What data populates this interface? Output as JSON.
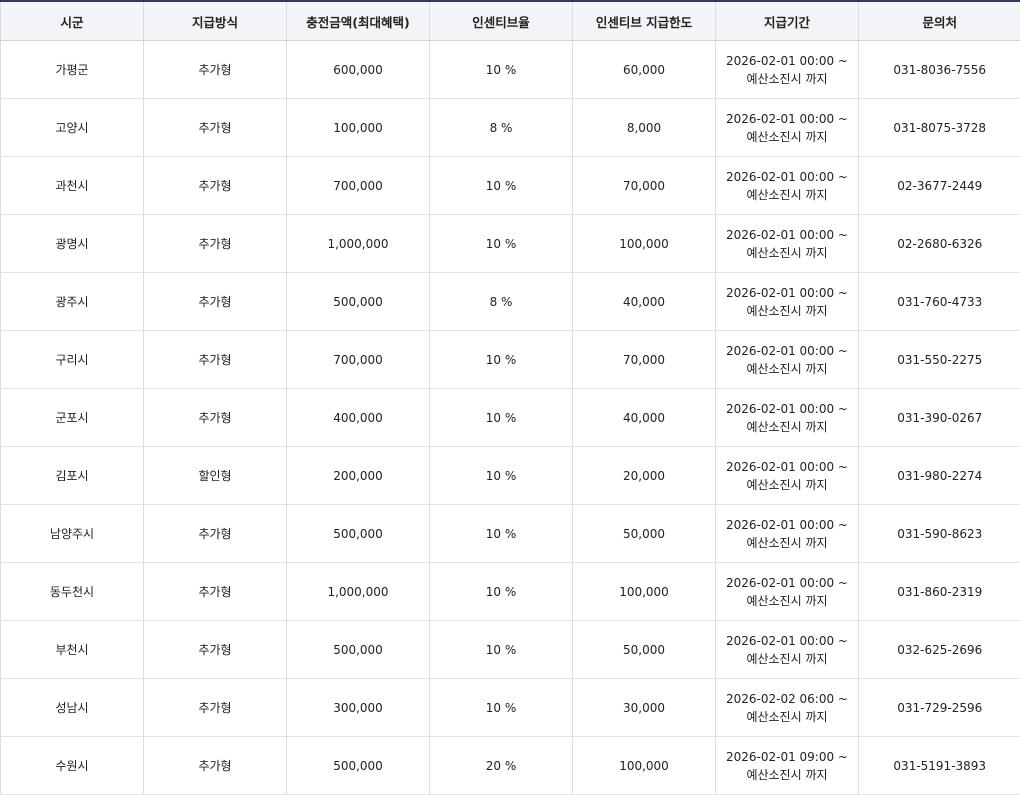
{
  "table": {
    "headers": [
      "시군",
      "지급방식",
      "충전금액(최대혜택)",
      "인센티브율",
      "인센티브 지급한도",
      "지급기간",
      "문의처"
    ],
    "rows": [
      {
        "region": "가평군",
        "method": "추가형",
        "amount": "600,000",
        "rate": "10 %",
        "limit": "60,000",
        "period": "2026-02-01 00:00 ~ 예산소진시 까지",
        "contact": "031-8036-7556"
      },
      {
        "region": "고양시",
        "method": "추가형",
        "amount": "100,000",
        "rate": "8 %",
        "limit": "8,000",
        "period": "2026-02-01 00:00 ~ 예산소진시 까지",
        "contact": "031-8075-3728"
      },
      {
        "region": "과천시",
        "method": "추가형",
        "amount": "700,000",
        "rate": "10 %",
        "limit": "70,000",
        "period": "2026-02-01 00:00 ~ 예산소진시 까지",
        "contact": "02-3677-2449"
      },
      {
        "region": "광명시",
        "method": "추가형",
        "amount": "1,000,000",
        "rate": "10 %",
        "limit": "100,000",
        "period": "2026-02-01 00:00 ~ 예산소진시 까지",
        "contact": "02-2680-6326"
      },
      {
        "region": "광주시",
        "method": "추가형",
        "amount": "500,000",
        "rate": "8 %",
        "limit": "40,000",
        "period": "2026-02-01 00:00 ~ 예산소진시 까지",
        "contact": "031-760-4733"
      },
      {
        "region": "구리시",
        "method": "추가형",
        "amount": "700,000",
        "rate": "10 %",
        "limit": "70,000",
        "period": "2026-02-01 00:00 ~ 예산소진시 까지",
        "contact": "031-550-2275"
      },
      {
        "region": "군포시",
        "method": "추가형",
        "amount": "400,000",
        "rate": "10 %",
        "limit": "40,000",
        "period": "2026-02-01 00:00 ~ 예산소진시 까지",
        "contact": "031-390-0267"
      },
      {
        "region": "김포시",
        "method": "할인형",
        "amount": "200,000",
        "rate": "10 %",
        "limit": "20,000",
        "period": "2026-02-01 00:00 ~ 예산소진시 까지",
        "contact": "031-980-2274"
      },
      {
        "region": "남양주시",
        "method": "추가형",
        "amount": "500,000",
        "rate": "10 %",
        "limit": "50,000",
        "period": "2026-02-01 00:00 ~ 예산소진시 까지",
        "contact": "031-590-8623"
      },
      {
        "region": "동두천시",
        "method": "추가형",
        "amount": "1,000,000",
        "rate": "10 %",
        "limit": "100,000",
        "period": "2026-02-01 00:00 ~ 예산소진시 까지",
        "contact": "031-860-2319"
      },
      {
        "region": "부천시",
        "method": "추가형",
        "amount": "500,000",
        "rate": "10 %",
        "limit": "50,000",
        "period": "2026-02-01 00:00 ~ 예산소진시 까지",
        "contact": "032-625-2696"
      },
      {
        "region": "성남시",
        "method": "추가형",
        "amount": "300,000",
        "rate": "10 %",
        "limit": "30,000",
        "period": "2026-02-02 06:00 ~ 예산소진시 까지",
        "contact": "031-729-2596"
      },
      {
        "region": "수원시",
        "method": "추가형",
        "amount": "500,000",
        "rate": "20 %",
        "limit": "100,000",
        "period": "2026-02-01 09:00 ~ 예산소진시 까지",
        "contact": "031-5191-3893"
      }
    ]
  },
  "colors": {
    "header_bg": "#f3f4f8",
    "top_border": "#2e3a63",
    "grid_line": "#dcdcdc",
    "text": "#222222"
  }
}
